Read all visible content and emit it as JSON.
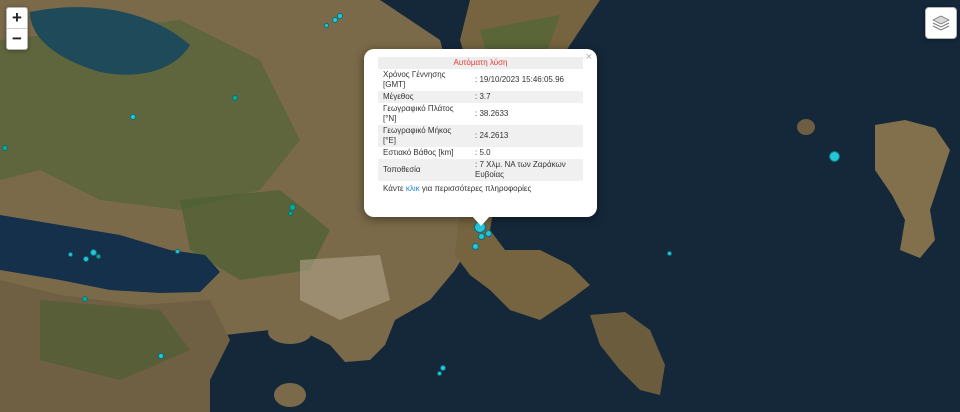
{
  "map": {
    "zoom_in_label": "+",
    "zoom_out_label": "−",
    "layers_icon": "layers-icon"
  },
  "popup": {
    "title": "Αυτόματη λύση",
    "close_label": "×",
    "rows": [
      {
        "label": "Χρόνος Γέννησης [GMT]",
        "value": ": 19/10/2023 15:46:05.96"
      },
      {
        "label": "Μέγεθος",
        "value": ": 3.7"
      },
      {
        "label": "Γεωγραφικό Πλάτος [°N]",
        "value": ": 38.2633"
      },
      {
        "label": "Γεωγραφικό Μήκος [°E]",
        "value": ": 24.2613"
      },
      {
        "label": "Εστιακό Βάθος [km]",
        "value": ": 5.0"
      },
      {
        "label": "Τοποθεσία",
        "value": ": 7 Χλμ. ΝΑ των Ζαράκων Ευβοίας"
      }
    ],
    "footer_prefix": "Κάντε ",
    "footer_link": "κλικ",
    "footer_suffix": " για περισσότερες πληροφορίες"
  },
  "colors": {
    "sea": "#14283a",
    "land": "#7b6a49",
    "vegetation": "#3f5a2e",
    "title_red": "#e53935",
    "link_blue": "#1e88e5",
    "quake_recent": "#26c6da",
    "quake_old": "#17a58a"
  }
}
